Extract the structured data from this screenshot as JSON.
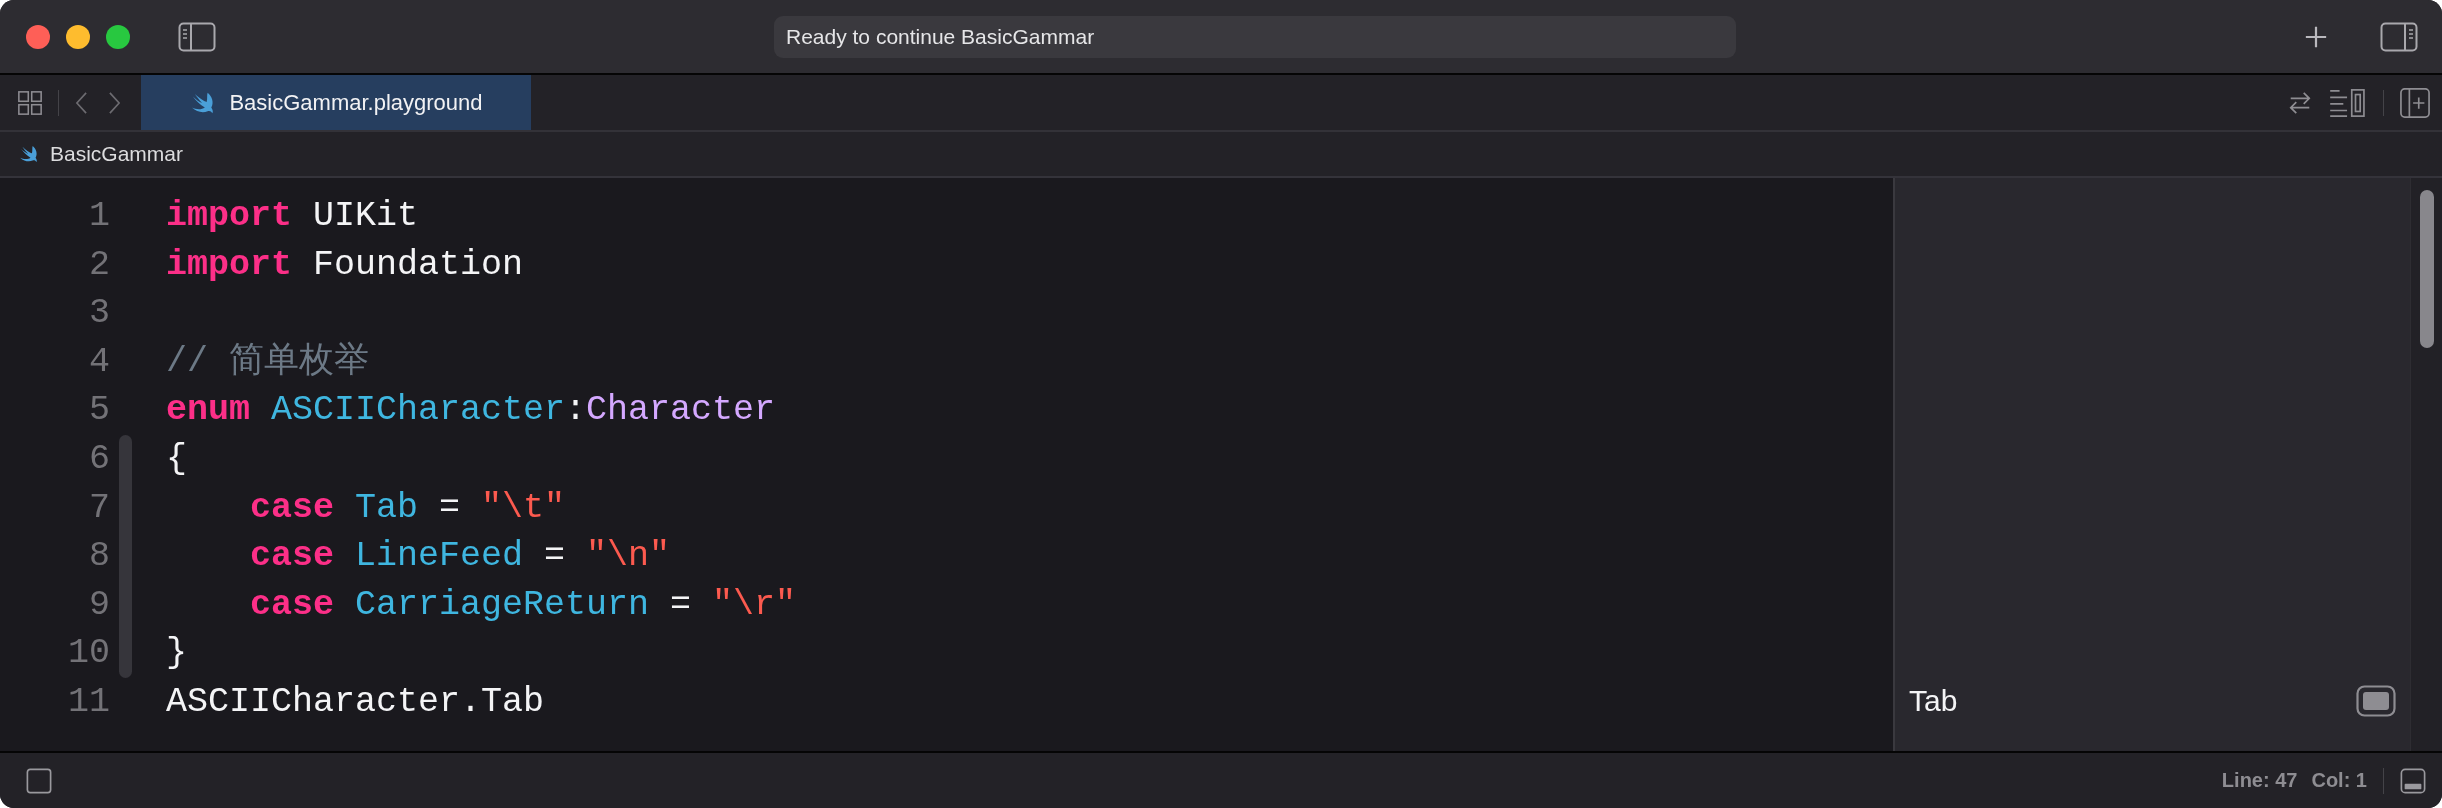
{
  "window": {
    "status": "Ready to continue BasicGammar"
  },
  "tabs": [
    {
      "label": "BasicGammar.playground",
      "selected": true
    }
  ],
  "breadcrumb": [
    "BasicGammar"
  ],
  "editor": {
    "lines": [
      {
        "number": "1",
        "tokens": [
          {
            "kind": "keyword",
            "text": "import"
          },
          {
            "kind": "plain",
            "text": "UIKit"
          }
        ]
      },
      {
        "number": "2",
        "tokens": [
          {
            "kind": "keyword",
            "text": "import"
          },
          {
            "kind": "plain",
            "text": "Foundation"
          }
        ]
      },
      {
        "number": "3"
      },
      {
        "number": "4",
        "tokens": [
          {
            "kind": "comment",
            "text": "// 简单枚举"
          }
        ]
      },
      {
        "number": "5",
        "tokens": [
          {
            "kind": "keyword",
            "text": "enum"
          },
          {
            "kind": "declaration",
            "text": "ASCIICharacter"
          },
          {
            "kind": "plain",
            "text": ":"
          },
          {
            "kind": "type",
            "text": "Character"
          }
        ]
      },
      {
        "number": "6",
        "in_scope": true,
        "tokens": [
          {
            "kind": "plain",
            "text": "{"
          }
        ]
      },
      {
        "number": "7",
        "indented": true,
        "in_scope": true,
        "tokens": [
          {
            "kind": "keyword",
            "text": "case"
          },
          {
            "kind": "declaration",
            "text": "Tab"
          },
          {
            "kind": "plain",
            "text": " = "
          },
          {
            "kind": "string",
            "text": "\"\\t\""
          }
        ]
      },
      {
        "number": "8",
        "indented": true,
        "in_scope": true,
        "tokens": [
          {
            "kind": "keyword",
            "text": "case"
          },
          {
            "kind": "declaration",
            "text": "LineFeed"
          },
          {
            "kind": "plain",
            "text": " = "
          },
          {
            "kind": "string",
            "text": "\"\\n\""
          }
        ]
      },
      {
        "number": "9",
        "indented": true,
        "in_scope": true,
        "tokens": [
          {
            "kind": "keyword",
            "text": "case"
          },
          {
            "kind": "declaration",
            "text": "CarriageReturn"
          },
          {
            "kind": "plain",
            "text": " = "
          },
          {
            "kind": "string",
            "text": "\"\\r\""
          }
        ]
      },
      {
        "number": "10",
        "in_scope": true,
        "tokens": [
          {
            "kind": "plain",
            "text": "}"
          }
        ]
      },
      {
        "number": "11",
        "tokens": [
          {
            "kind": "plain",
            "text": "ASCIICharacter.Tab"
          }
        ]
      }
    ]
  },
  "results": [
    {
      "text": "Tab"
    }
  ],
  "status_bar": {
    "line": "Line: 47",
    "column": "Col: 1"
  }
}
